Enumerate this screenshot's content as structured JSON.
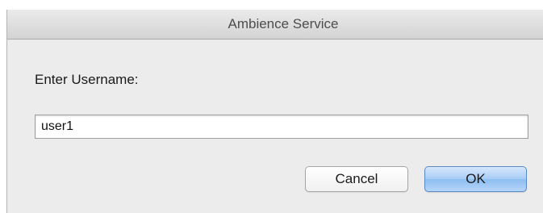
{
  "dialog": {
    "title": "Ambience Service",
    "prompt": "Enter Username:",
    "username_value": "user1",
    "cancel_label": "Cancel",
    "ok_label": "OK"
  }
}
